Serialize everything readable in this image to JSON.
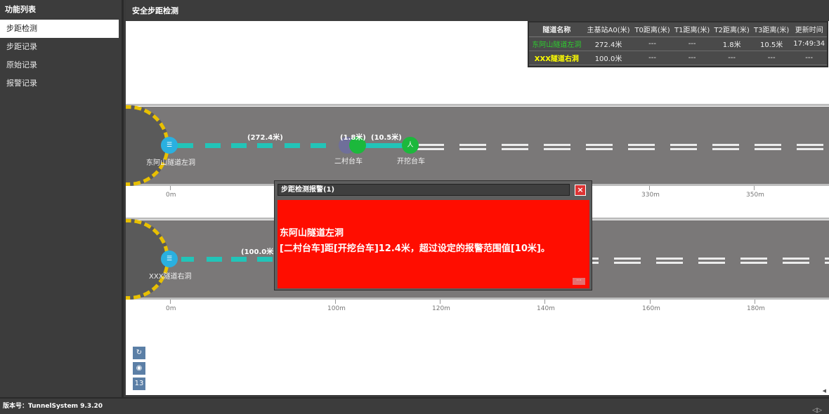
{
  "sidebar": {
    "title": "功能列表",
    "items": [
      {
        "label": "步距检测",
        "active": true
      },
      {
        "label": "步距记录",
        "active": false
      },
      {
        "label": "原始记录",
        "active": false
      },
      {
        "label": "报警记录",
        "active": false
      }
    ]
  },
  "main": {
    "title": "安全步距检测"
  },
  "status_table": {
    "headers": [
      "隧道名称",
      "主基站A0(米)",
      "T0距离(米)",
      "T1距离(米)",
      "T2距离(米)",
      "T3距离(米)",
      "更新时间"
    ],
    "rows": [
      {
        "cells": [
          "东阿山隧道左洞",
          "272.4米",
          "---",
          "---",
          "1.8米",
          "10.5米",
          "17:49:34"
        ],
        "name_color": "#2ecc2e"
      },
      {
        "cells": [
          "XXX隧道右洞",
          "100.0米",
          "---",
          "---",
          "---",
          "---",
          "---"
        ],
        "name_color": "#ffff00"
      }
    ]
  },
  "tunnel1": {
    "name": "东阿山隧道左洞",
    "dist_a0": "(272.4米)",
    "dist_t2": "(1.8米)",
    "dist_t3": "(10.5米)",
    "node_t2_label": "二村台车",
    "node_t3_label": "开挖台车",
    "ticks": [
      "0m",
      "330m",
      "350m"
    ]
  },
  "tunnel2": {
    "name": "XXX隧道右洞",
    "dist_a0": "(100.0米)",
    "ticks": [
      "0m",
      "100m",
      "120m",
      "140m",
      "160m",
      "180m"
    ]
  },
  "toolbar": {
    "refresh_icon": "refresh-icon",
    "locate_icon": "locate-icon",
    "zoom_level": "13"
  },
  "alarm": {
    "title": "步距检测报警(1)",
    "close": "×",
    "line1": "东阿山隧道左洞",
    "line2": "[二村台车]距[开挖台车]12.4米，超过设定的报警范围值[10米]。",
    "more": "···"
  },
  "footer": {
    "version": "版本号：TunnelSystem 9.3.20"
  },
  "colors": {
    "accent": "#22c4b8",
    "alarm": "#ff0d00",
    "node_blue": "#2ab0e0",
    "node_green": "#1cb83c",
    "node_gray": "#6f6f9a"
  }
}
